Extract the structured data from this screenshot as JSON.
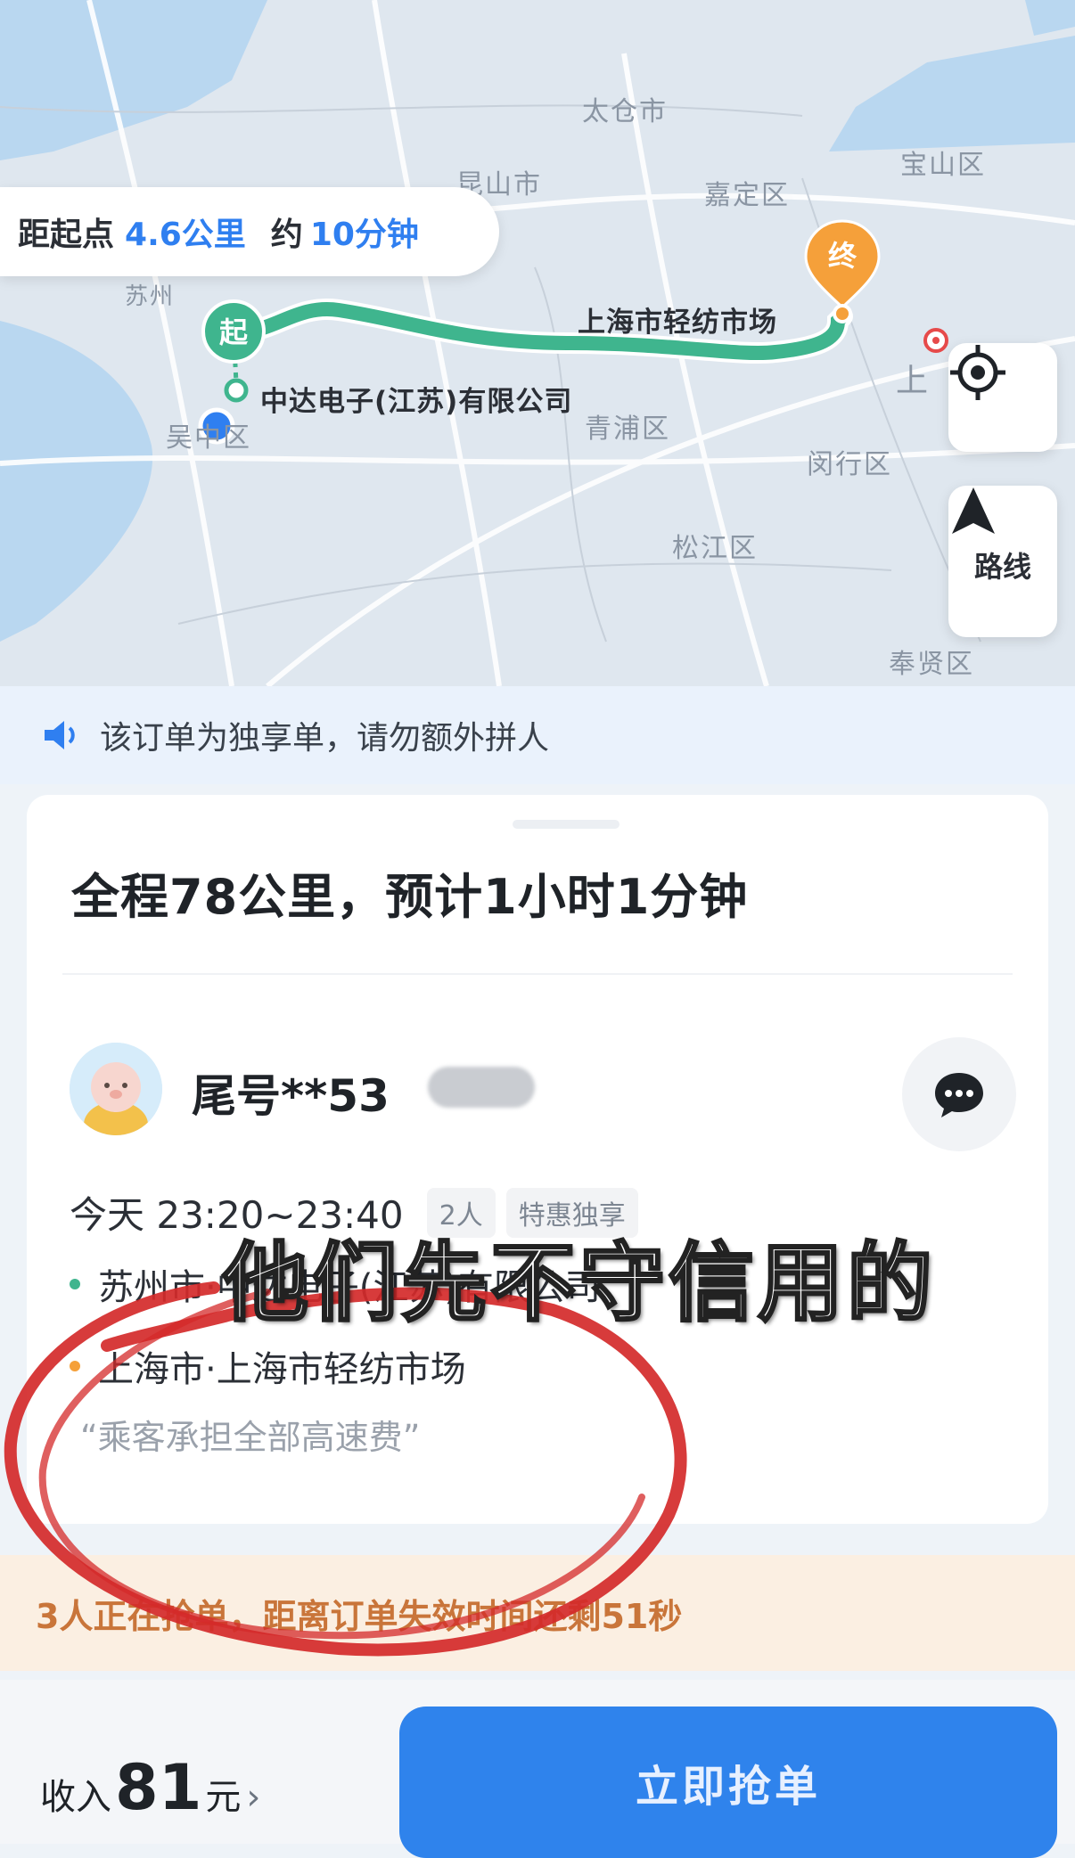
{
  "map": {
    "labels": {
      "taicang": "太仓市",
      "kunshan": "昆山市",
      "jiading": "嘉定区",
      "baoshan": "宝山区",
      "suzhou": "苏州",
      "wuzhong": "吴中区",
      "qingpu": "青浦区",
      "minhang": "闵行区",
      "songjiang": "松江区",
      "fengxian": "奉贤区",
      "shanghai": "上"
    },
    "start_marker": "起",
    "end_marker": "终",
    "start_place": "中达电子(江苏)有限公司",
    "end_place": "上海市轻纺市场",
    "colors": {
      "route": "#3fb58e",
      "end": "#f5a03a",
      "self_dot": "#2f7ff0"
    }
  },
  "distance_pill": {
    "prefix": "距起点",
    "distance": "4.6公里",
    "mid": "约",
    "eta": "10分钟"
  },
  "map_buttons": {
    "locate_icon": "locate-icon",
    "route_label": "路线"
  },
  "notice": {
    "text": "该订单为独享单，请勿额外拼人"
  },
  "trip": {
    "summary": "全程78公里，预计1小时1分钟",
    "passenger": "尾号**53",
    "time": "今天 23:20~23:40",
    "tags": [
      "2人",
      "特惠独享"
    ],
    "pickup": "苏州市·中达电子(江苏)有限公司",
    "dropoff": "上海市·上海市轻纺市场",
    "note": "“乘客承担全部高速费”"
  },
  "grab_status": {
    "text": "3人正在抢单，距离订单失效时间还剩51秒"
  },
  "footer": {
    "income_prefix": "收入",
    "income_value": "81",
    "income_unit": "元",
    "chevron": "›",
    "grab_button": "立即抢单"
  },
  "overlay": {
    "caption": "他们先不守信用的",
    "annotation_color": "#d42a2a"
  }
}
